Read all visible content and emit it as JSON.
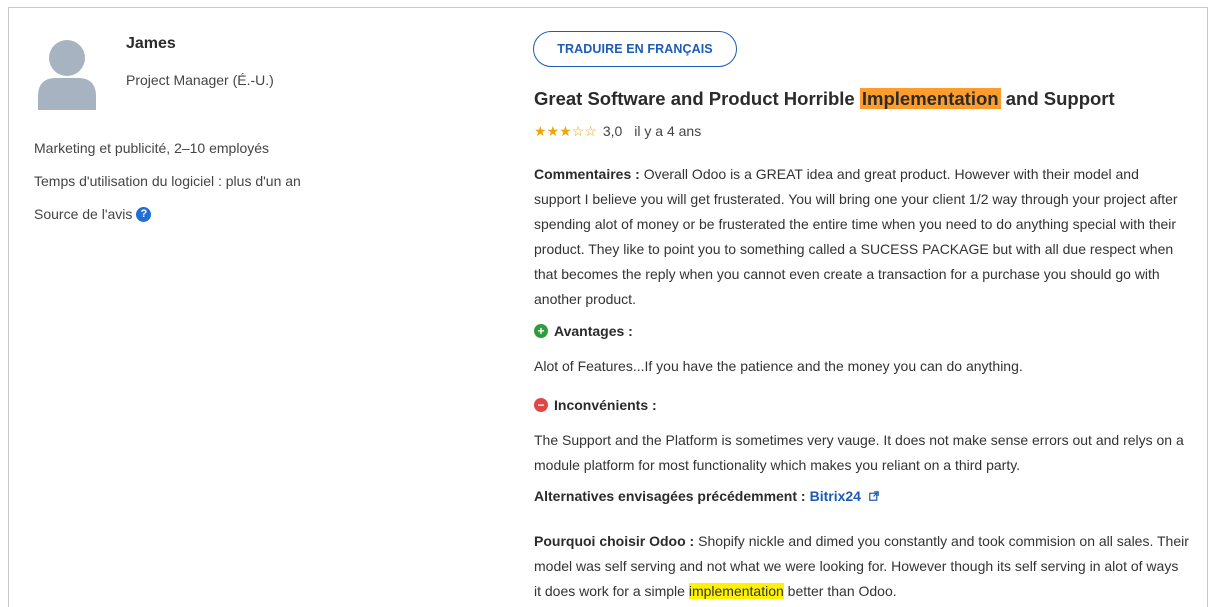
{
  "reviewer": {
    "name": "James",
    "role": "Project Manager (É.-U.)",
    "industry": "Marketing et publicité, 2–10 employés",
    "usage": "Temps d'utilisation du logiciel : plus d'un an",
    "source_label": "Source de l'avis"
  },
  "review": {
    "translate_label": "TRADUIRE EN FRANÇAIS",
    "title_before": "Great Software and Product Horrible ",
    "title_highlight": "Implementation",
    "title_after": " and Support",
    "rating": 3.0,
    "rating_text": "3,0",
    "age": "il y a 4 ans",
    "comments_label": "Commentaires :",
    "comments_text": " Overall Odoo is a GREAT idea and great product. However with their model and support I believe you will get frusterated. You will bring one your client 1/2 way through your project after spending alot of money or be frusterated the entire time when you need to do anything special with their product. They like to point you to something called a SUCESS PACKAGE but with all due respect when that becomes the reply when you cannot even create a transaction for a purchase you should go with another product.",
    "pros_label": "Avantages :",
    "pros_text": "Alot of Features...If you have the patience and the money you can do anything.",
    "cons_label": "Inconvénients :",
    "cons_text": "The Support and the Platform is sometimes very vauge. It does not make sense errors out and relys on a module platform for most functionality which makes you reliant on a third party.",
    "alternatives_label": "Alternatives envisagées précédemment :",
    "alternatives_value": "Bitrix24",
    "why_label": "Pourquoi choisir Odoo :",
    "why_text_before": " Shopify nickle and dimed you constantly and took commision on all sales. Their model was self serving and not what we were looking for. However though its self serving in alot of ways it does work for a simple ",
    "why_highlight": "implementation",
    "why_text_after": " better than Odoo."
  },
  "colors": {
    "accent": "#1c5bb8",
    "star": "#f0a500",
    "highlight_orange": "#ff9d2c",
    "highlight_yellow": "#fff200",
    "pros_icon": "#2e9e3d",
    "cons_icon": "#e04848"
  },
  "icons": {
    "avatar": "user-avatar-icon",
    "source_info": "question-circle-icon",
    "pros": "plus-circle-icon",
    "cons": "minus-circle-icon",
    "external_link": "external-link-icon"
  }
}
